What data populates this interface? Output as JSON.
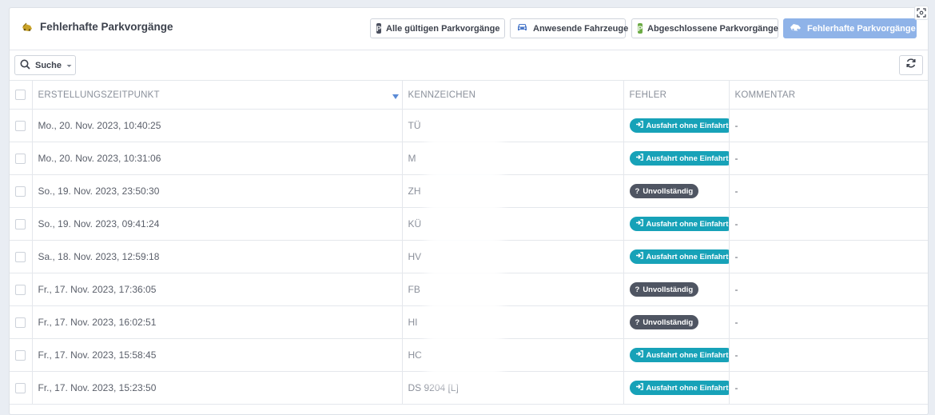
{
  "header": {
    "title": "Fehlerhafte Parkvorgänge"
  },
  "tabs": [
    {
      "label": "Alle gültigen Parkvorgänge",
      "icon": "parking-icon"
    },
    {
      "label": "Anwesende Fahrzeuge",
      "icon": "car-icon"
    },
    {
      "label": "Abgeschlossene Parkvorgänge",
      "icon": "parking-icon"
    },
    {
      "label": "Fehlerhafte Parkvorgänge",
      "icon": "crashed-car-icon",
      "active": true
    }
  ],
  "toolbar": {
    "search_label": "Suche"
  },
  "table": {
    "columns": [
      "ERSTELLUNGSZEITPUNKT",
      "KENNZEICHEN",
      "FEHLER",
      "KOMMENTAR"
    ],
    "rows": [
      {
        "created": "Mo., 20. Nov. 2023, 10:40:25",
        "plate": "TÜ",
        "error": "Ausfahrt ohne Einfahrt",
        "comment": "-"
      },
      {
        "created": "Mo., 20. Nov. 2023, 10:31:06",
        "plate": "M",
        "error": "Ausfahrt ohne Einfahrt",
        "comment": "-"
      },
      {
        "created": "So., 19. Nov. 2023, 23:50:30",
        "plate": "ZH",
        "error": "Unvollständig",
        "comment": "-"
      },
      {
        "created": "So., 19. Nov. 2023, 09:41:24",
        "plate": "KÜ",
        "error": "Ausfahrt ohne Einfahrt",
        "comment": "-"
      },
      {
        "created": "Sa., 18. Nov. 2023, 12:59:18",
        "plate": "HV",
        "error": "Ausfahrt ohne Einfahrt",
        "comment": "-"
      },
      {
        "created": "Fr., 17. Nov. 2023, 17:36:05",
        "plate": "FB",
        "error": "Unvollständig",
        "comment": "-"
      },
      {
        "created": "Fr., 17. Nov. 2023, 16:02:51",
        "plate": "HI",
        "error": "Unvollständig",
        "comment": "-"
      },
      {
        "created": "Fr., 17. Nov. 2023, 15:58:45",
        "plate": "HC",
        "error": "Ausfahrt ohne Einfahrt",
        "comment": "-"
      },
      {
        "created": "Fr., 17. Nov. 2023, 15:23:50",
        "plate": "DS 9204 [L]",
        "error": "Ausfahrt ohne Einfahrt",
        "comment": "-"
      }
    ]
  },
  "colors": {
    "exit_badge": "#17a2b8",
    "incomplete_badge": "#4f5562",
    "active_tab": "#8fb3e8",
    "parking_badge_dark": "#4a4f5e",
    "parking_badge_green": "#6cab45",
    "car_icon": "#4a78c9",
    "title_icon": "#c9a227"
  }
}
